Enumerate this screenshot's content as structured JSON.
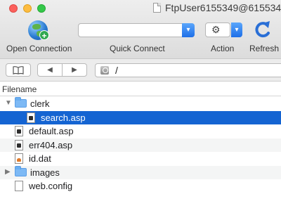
{
  "window": {
    "title": "FtpUser6155349@6155349"
  },
  "toolbar": {
    "open_connection_label": "Open Connection",
    "quick_connect_label": "Quick Connect",
    "quick_connect_value": "",
    "action_label": "Action",
    "refresh_label": "Refresh"
  },
  "navigation": {
    "path": "/"
  },
  "file_list": {
    "column_header": "Filename",
    "rows": [
      {
        "name": "clerk",
        "type": "folder",
        "expanded": true
      },
      {
        "name": "search.asp",
        "type": "file",
        "selected": true
      },
      {
        "name": "default.asp",
        "type": "file"
      },
      {
        "name": "err404.asp",
        "type": "file"
      },
      {
        "name": "id.dat",
        "type": "file"
      },
      {
        "name": "images",
        "type": "folder",
        "expanded": false
      },
      {
        "name": "web.config",
        "type": "file"
      }
    ]
  },
  "colors": {
    "selection": "#1464d2",
    "accent_dropdown": "#1e6fe8",
    "folder": "#7db9f5"
  }
}
